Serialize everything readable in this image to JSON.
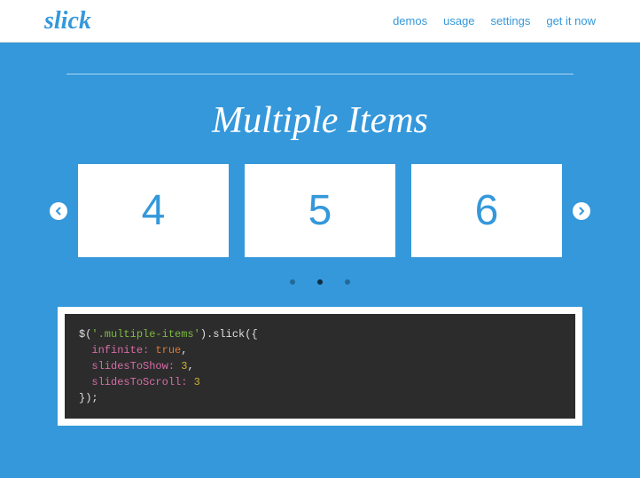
{
  "header": {
    "logo": "slick",
    "nav": {
      "demos": "demos",
      "usage": "usage",
      "settings": "settings",
      "get_it_now": "get it now"
    }
  },
  "section": {
    "title": "Multiple Items"
  },
  "slides": {
    "item1": "4",
    "item2": "5",
    "item3": "6"
  },
  "code": {
    "selector_open": "$(",
    "selector_string": "'.multiple-items'",
    "method": ").slick({",
    "prop1_key": "infinite:",
    "prop1_val": " true",
    "comma1": ",",
    "prop2_key": "slidesToShow:",
    "prop2_val": " 3",
    "comma2": ",",
    "prop3_key": "slidesToScroll:",
    "prop3_val": " 3",
    "close": "});"
  }
}
